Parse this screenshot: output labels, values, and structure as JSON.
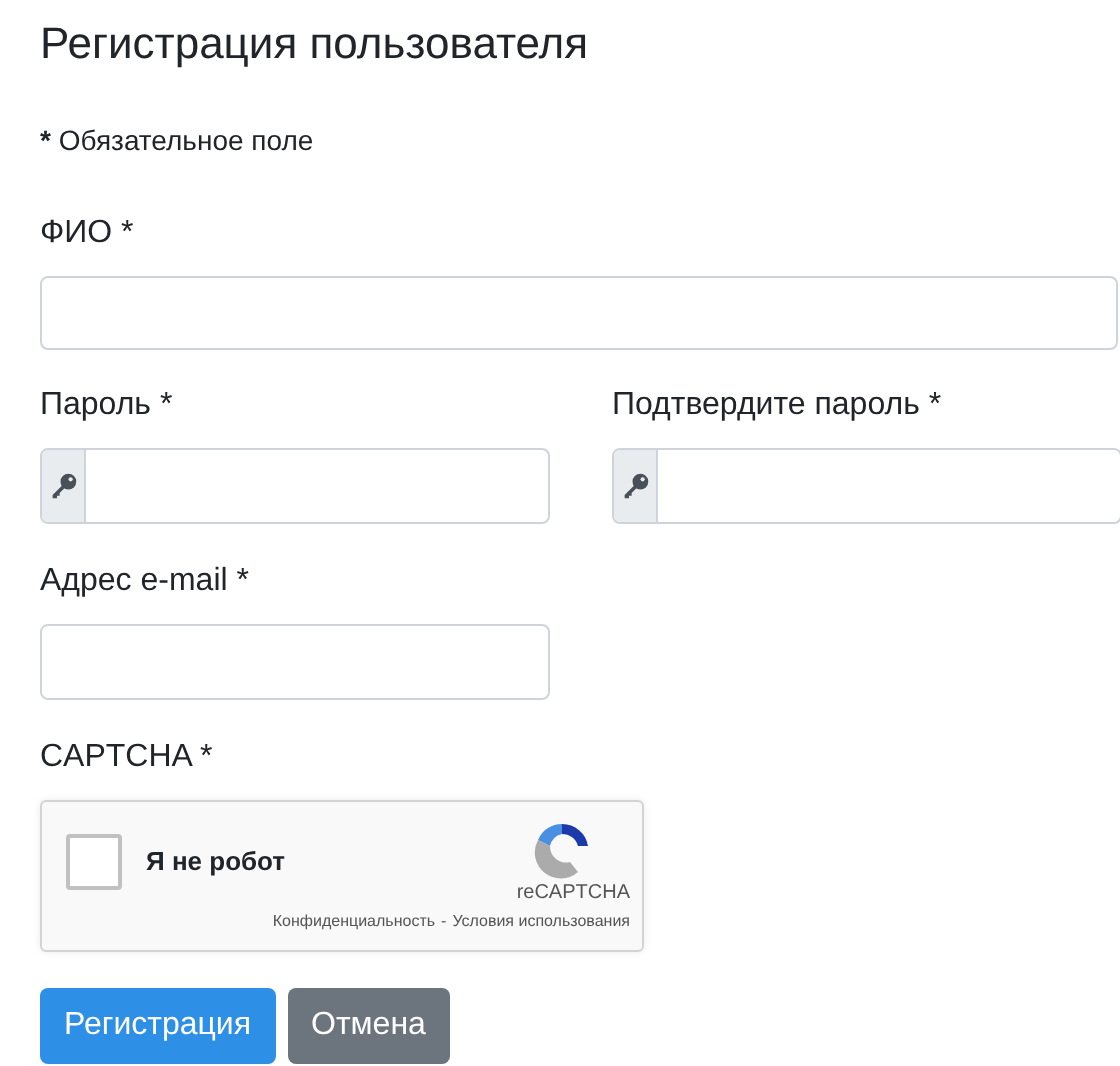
{
  "title": "Регистрация пользователя",
  "required_note": {
    "mark": "*",
    "text": "Обязательное поле"
  },
  "full_name": {
    "label": "ФИО *"
  },
  "password": {
    "label": "Пароль *"
  },
  "confirm_password": {
    "label": "Подтвердите пароль *"
  },
  "email": {
    "label": "Адрес e-mail *"
  },
  "captcha": {
    "label": "CAPTCHA *",
    "checkbox_label": "Я не робот",
    "checked": false,
    "brand": "reCAPTCHA",
    "privacy_link": "Конфиденциальность",
    "separator": "-",
    "terms_link": "Условия использования"
  },
  "buttons": [
    {
      "label": "Регистрация",
      "kind": "primary"
    },
    {
      "label": "Отмена",
      "kind": "secondary"
    }
  ]
}
